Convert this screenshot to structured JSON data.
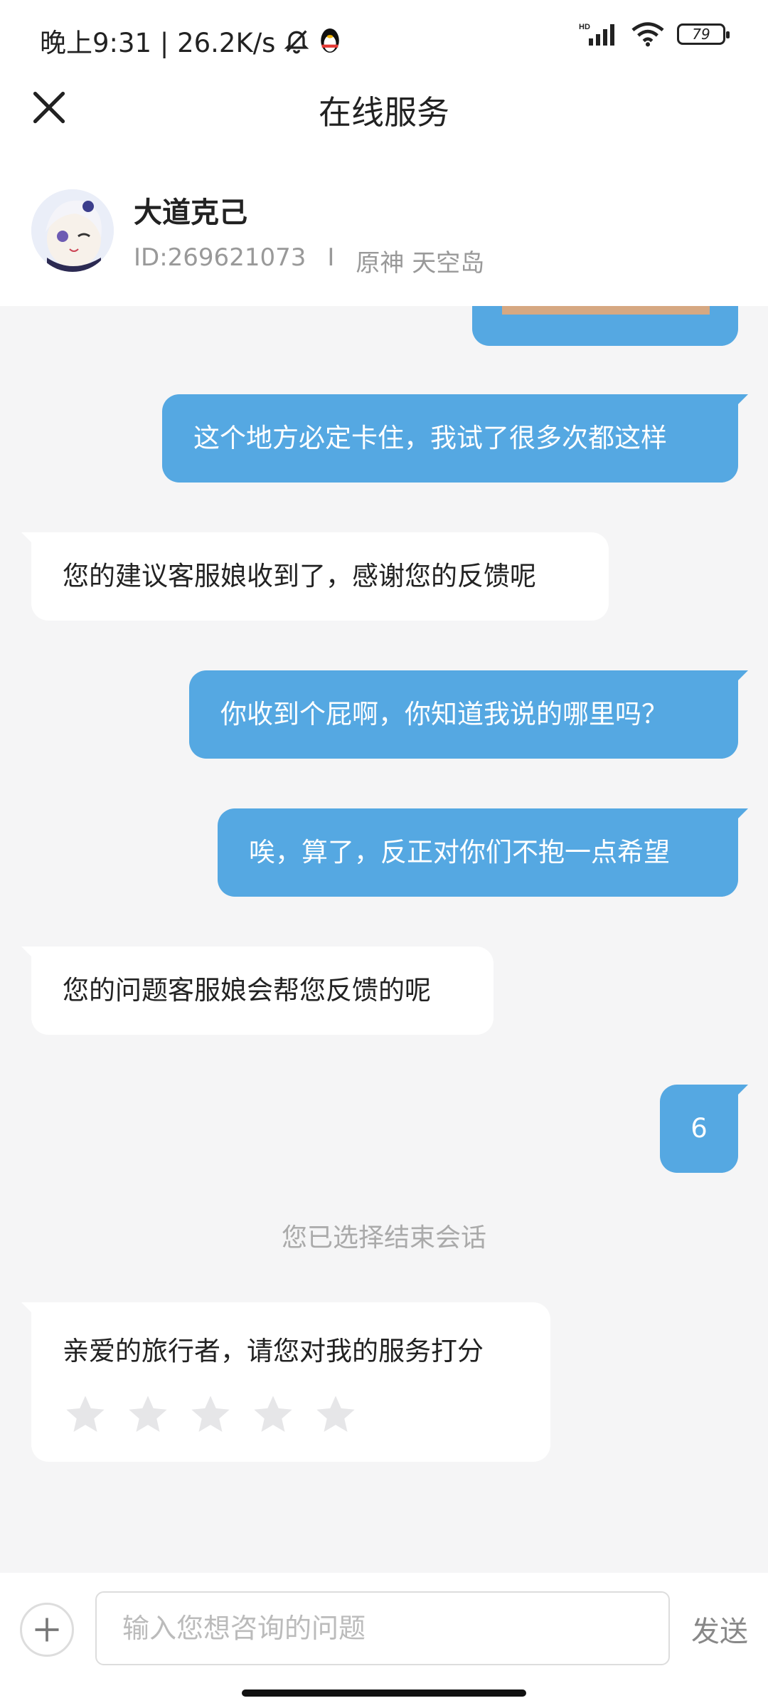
{
  "status_bar": {
    "time_speed": "晚上9:31 | 26.2K/s",
    "network": "HD",
    "battery": "79"
  },
  "header": {
    "title": "在线服务"
  },
  "profile": {
    "name": "大道克己",
    "id": "ID:269621073",
    "separator": "I",
    "game_server": "原神 天空岛"
  },
  "messages": [
    {
      "from": "user",
      "text": "这个地方必定卡住，我试了很多次都这样"
    },
    {
      "from": "agent",
      "text": "您的建议客服娘收到了，感谢您的反馈呢"
    },
    {
      "from": "user",
      "text": "你收到个屁啊，你知道我说的哪里吗？"
    },
    {
      "from": "user",
      "text": "唉，算了，反正对你们不抱一点希望"
    },
    {
      "from": "agent",
      "text": "您的问题客服娘会帮您反馈的呢"
    },
    {
      "from": "user",
      "text": "6"
    }
  ],
  "notice": "您已选择结束会话",
  "rating": {
    "prompt": "亲爱的旅行者，请您对我的服务打分",
    "stars_total": 5,
    "stars_selected": 0
  },
  "input": {
    "placeholder": "输入您想咨询的问题",
    "send_label": "发送"
  },
  "colors": {
    "user_bubble": "#55a8e2",
    "agent_bubble": "#ffffff",
    "chat_background": "#f5f5f6"
  },
  "icons": [
    "close-icon",
    "plus-icon",
    "star-icon",
    "mute-bell-icon",
    "qq-penguin-icon",
    "signal-icon",
    "wifi-icon",
    "battery-icon"
  ]
}
